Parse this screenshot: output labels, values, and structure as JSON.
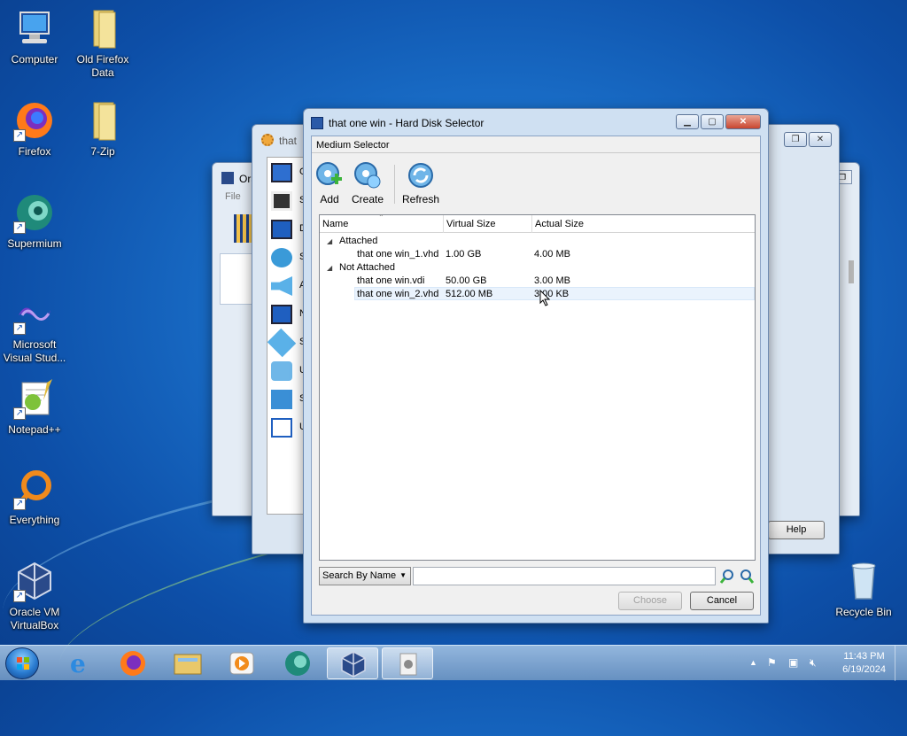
{
  "desktop": {
    "icons": [
      {
        "label": "Computer",
        "name": "computer"
      },
      {
        "label": "Old Firefox Data",
        "name": "folder"
      },
      {
        "label": "Firefox",
        "name": "firefox"
      },
      {
        "label": "7-Zip",
        "name": "folder"
      },
      {
        "label": "Supermium",
        "name": "supermium"
      },
      {
        "label": "Microsoft Visual Stud...",
        "name": "visual-studio"
      },
      {
        "label": "Notepad++",
        "name": "notepad-plus-plus"
      },
      {
        "label": "Everything",
        "name": "everything"
      },
      {
        "label": "Oracle VM VirtualBox",
        "name": "virtualbox"
      },
      {
        "label": "Recycle Bin",
        "name": "recycle-bin"
      }
    ]
  },
  "background_windows": {
    "oracle": {
      "title_fragment": "Ora",
      "menu_file": "File"
    },
    "settings": {
      "title_fragment": "that",
      "help_label": "Help",
      "side_letters": [
        "G",
        "S",
        "D",
        "S",
        "A",
        "N",
        "S",
        "U",
        "S",
        "U"
      ]
    }
  },
  "dialog": {
    "title": "that one win - Hard Disk Selector",
    "menu_label": "Medium Selector",
    "toolbar": {
      "add": "Add",
      "create": "Create",
      "refresh": "Refresh"
    },
    "columns": {
      "name": "Name",
      "virtual": "Virtual Size",
      "actual": "Actual Size"
    },
    "groups": {
      "attached": {
        "label": "Attached",
        "items": [
          {
            "name": "that one win_1.vhd",
            "virtual": "1.00 GB",
            "actual": "4.00 MB"
          }
        ]
      },
      "not_attached": {
        "label": "Not Attached",
        "items": [
          {
            "name": "that one win.vdi",
            "virtual": "50.00 GB",
            "actual": "3.00 MB"
          },
          {
            "name": "that one win_2.vhd",
            "virtual": "512.00 MB",
            "actual": "3.00 KB"
          }
        ]
      }
    },
    "search_mode": "Search By Name",
    "search_value": "",
    "buttons": {
      "choose": "Choose",
      "cancel": "Cancel"
    }
  },
  "taskbar": {
    "clock_time": "11:43 PM",
    "clock_date": "6/19/2024",
    "apps": [
      "internet-explorer",
      "firefox",
      "file-explorer",
      "media-player",
      "supermium",
      "virtualbox",
      "settings-window"
    ],
    "active_app": "virtualbox"
  }
}
